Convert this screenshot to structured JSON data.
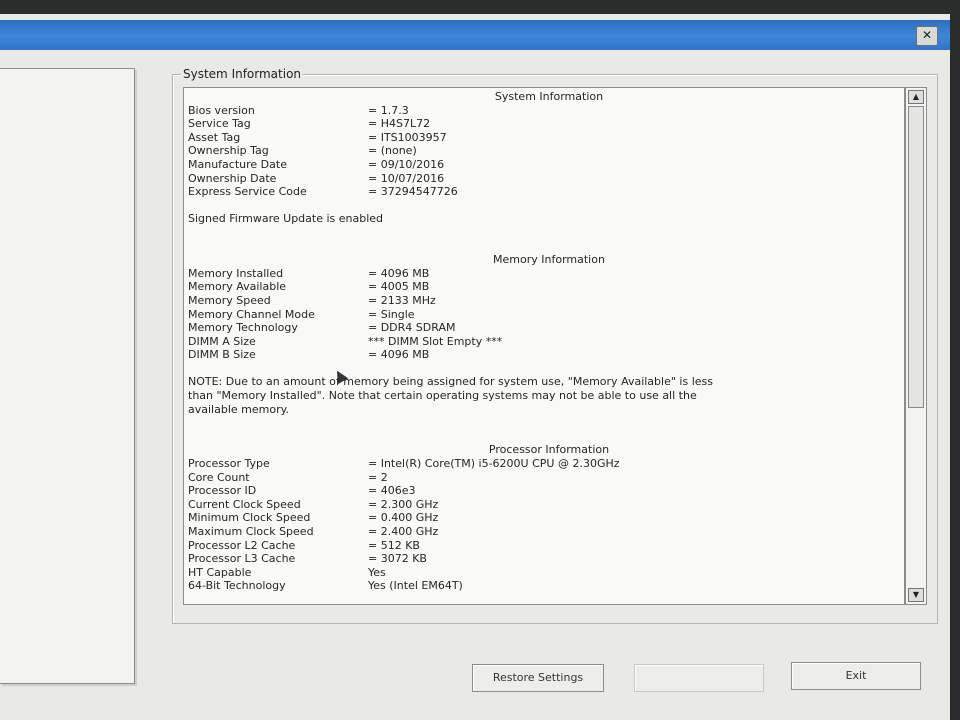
{
  "window": {
    "close_label": "✕"
  },
  "groupbox": {
    "title": "System Information"
  },
  "sections": {
    "system": {
      "heading": "System Information",
      "rows": [
        {
          "label": "Bios version",
          "value": "= 1.7.3"
        },
        {
          "label": "Service Tag",
          "value": "= H4S7L72"
        },
        {
          "label": "Asset Tag",
          "value": "= ITS1003957"
        },
        {
          "label": "Ownership Tag",
          "value": "= (none)"
        },
        {
          "label": "Manufacture Date",
          "value": "= 09/10/2016"
        },
        {
          "label": "Ownership Date",
          "value": "= 10/07/2016"
        },
        {
          "label": "Express Service Code",
          "value": "= 37294547726"
        }
      ],
      "firmware_note": "Signed Firmware Update is enabled"
    },
    "memory": {
      "heading": "Memory Information",
      "rows": [
        {
          "label": "Memory Installed",
          "value": "= 4096 MB"
        },
        {
          "label": "Memory Available",
          "value": "= 4005 MB"
        },
        {
          "label": "Memory Speed",
          "value": "= 2133 MHz"
        },
        {
          "label": "Memory Channel Mode",
          "value": "= Single"
        },
        {
          "label": "Memory Technology",
          "value": "= DDR4 SDRAM"
        },
        {
          "label": "DIMM A Size",
          "value": "*** DIMM Slot Empty ***"
        },
        {
          "label": "DIMM B Size",
          "value": "= 4096 MB"
        }
      ],
      "note_lines": [
        "NOTE: Due to an amount of memory being assigned for system use, \"Memory Available\" is less",
        "than \"Memory Installed\". Note that certain operating systems may not be able to use all the",
        "available memory."
      ]
    },
    "processor": {
      "heading": "Processor Information",
      "rows": [
        {
          "label": "Processor Type",
          "value": "= Intel(R) Core(TM) i5-6200U CPU @ 2.30GHz"
        },
        {
          "label": "Core Count",
          "value": "= 2"
        },
        {
          "label": "Processor ID",
          "value": "= 406e3"
        },
        {
          "label": "Current Clock Speed",
          "value": "= 2.300 GHz"
        },
        {
          "label": "Minimum Clock Speed",
          "value": "= 0.400 GHz"
        },
        {
          "label": "Maximum Clock Speed",
          "value": "= 2.400 GHz"
        },
        {
          "label": "Processor L2 Cache",
          "value": "= 512 KB"
        },
        {
          "label": "Processor L3 Cache",
          "value": "= 3072 KB"
        },
        {
          "label": "HT Capable",
          "value": "Yes"
        },
        {
          "label": "64-Bit Technology",
          "value": "Yes (Intel EM64T)"
        }
      ]
    }
  },
  "scrollbar": {
    "up_icon": "▲",
    "down_icon": "▼"
  },
  "buttons": {
    "restore": "Restore Settings",
    "exit": "Exit"
  }
}
